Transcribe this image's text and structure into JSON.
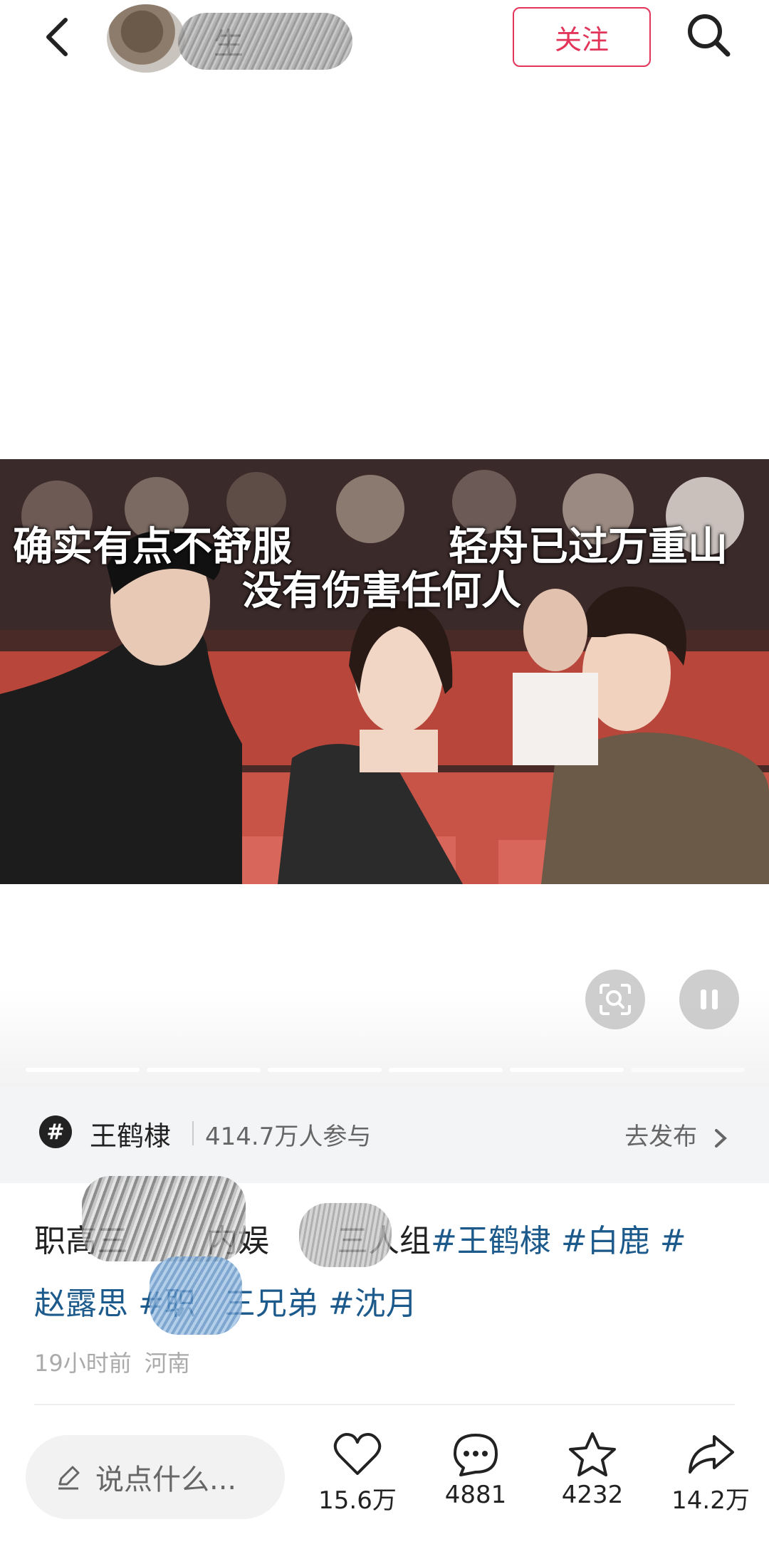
{
  "header": {
    "author_name": "生",
    "follow_label": "关注"
  },
  "media": {
    "captions": {
      "left": "确实有点不舒服",
      "right": "轻舟已过万重山",
      "center": "没有伤害任何人"
    }
  },
  "topic": {
    "name": "王鹤棣",
    "count": "414.7万人参与",
    "action_label": "去发布"
  },
  "post": {
    "text_prefix": "职高三",
    "text_mid": "内娱",
    "text_trio": "三人组",
    "tags": {
      "wang": "#王鹤棣",
      "bai": "#白鹿",
      "hash_end": "#",
      "zhao": "赵露思",
      "zhi": "#职",
      "brothers": "三兄弟",
      "shen": "#沈月"
    },
    "time": "19小时前",
    "location": "河南"
  },
  "bottom": {
    "comment_placeholder": "说点什么...",
    "likes": "15.6万",
    "comments": "4881",
    "favorites": "4232",
    "shares": "14.2万"
  },
  "colors": {
    "accent": "#e3345a",
    "tag": "#1d5a8c"
  }
}
